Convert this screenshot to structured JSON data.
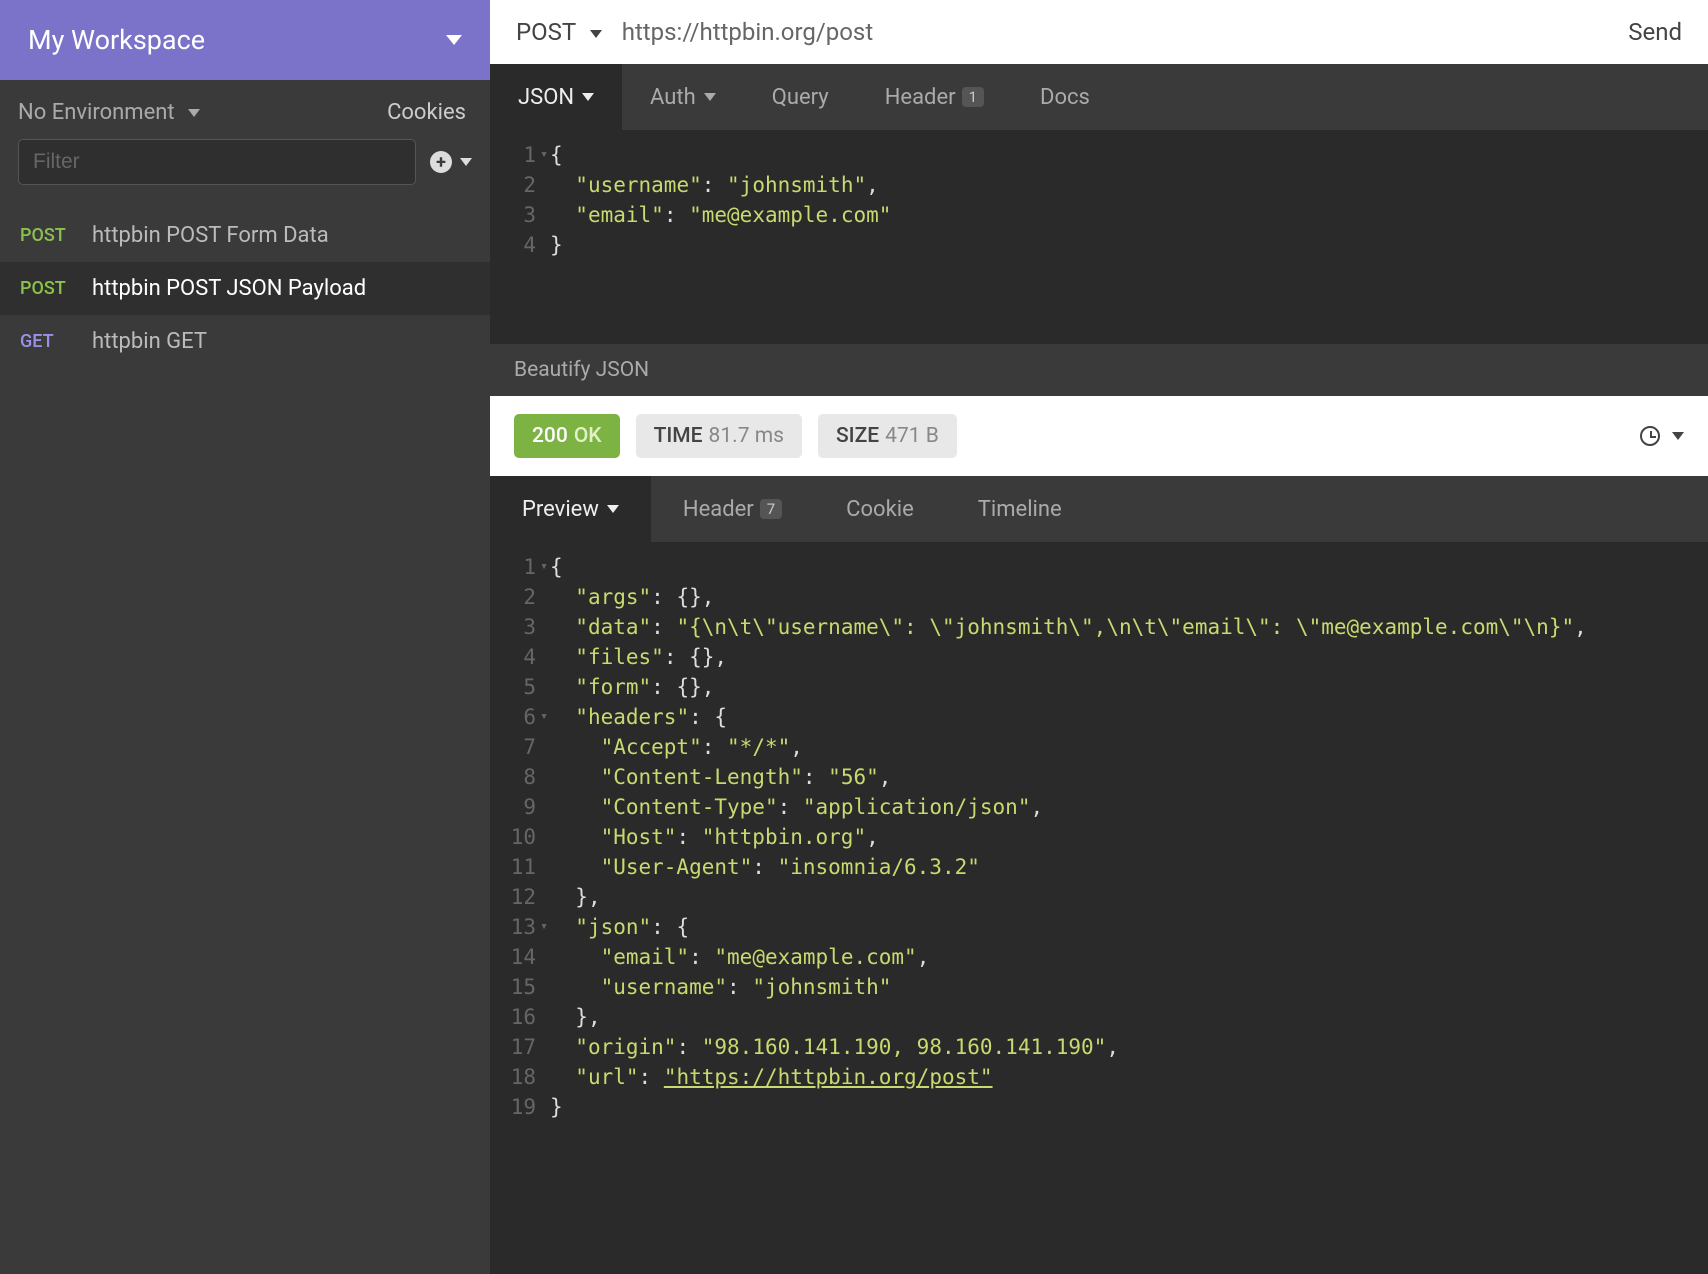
{
  "workspace": {
    "name": "My Workspace"
  },
  "sidebar": {
    "environment_label": "No Environment",
    "cookies_label": "Cookies",
    "filter_placeholder": "Filter",
    "requests": [
      {
        "method": "POST",
        "label": "httpbin POST Form Data",
        "active": false
      },
      {
        "method": "POST",
        "label": "httpbin POST JSON Payload",
        "active": true
      },
      {
        "method": "GET",
        "label": "httpbin GET",
        "active": false
      }
    ]
  },
  "url_bar": {
    "method": "POST",
    "url": "https://httpbin.org/post",
    "send_label": "Send"
  },
  "request_tabs": {
    "body": "JSON",
    "auth": "Auth",
    "query": "Query",
    "header": "Header",
    "header_badge": "1",
    "docs": "Docs"
  },
  "request_body_lines": [
    {
      "n": "1",
      "indent": 0,
      "fold": true,
      "tokens": [
        {
          "t": "punct",
          "v": "{"
        }
      ]
    },
    {
      "n": "2",
      "indent": 1,
      "tokens": [
        {
          "t": "key",
          "v": "\"username\""
        },
        {
          "t": "punct",
          "v": ": "
        },
        {
          "t": "str",
          "v": "\"johnsmith\""
        },
        {
          "t": "punct",
          "v": ","
        }
      ]
    },
    {
      "n": "3",
      "indent": 1,
      "tokens": [
        {
          "t": "key",
          "v": "\"email\""
        },
        {
          "t": "punct",
          "v": ": "
        },
        {
          "t": "str",
          "v": "\"me@example.com\""
        }
      ]
    },
    {
      "n": "4",
      "indent": 0,
      "tokens": [
        {
          "t": "punct",
          "v": "}"
        }
      ]
    }
  ],
  "beautify_label": "Beautify JSON",
  "status": {
    "code": "200",
    "text": "OK",
    "time_label": "TIME",
    "time_value": "81.7 ms",
    "size_label": "SIZE",
    "size_value": "471 B"
  },
  "response_tabs": {
    "preview": "Preview",
    "header": "Header",
    "header_badge": "7",
    "cookie": "Cookie",
    "timeline": "Timeline"
  },
  "response_body_lines": [
    {
      "n": "1",
      "indent": 0,
      "fold": true,
      "tokens": [
        {
          "t": "punct",
          "v": "{"
        }
      ]
    },
    {
      "n": "2",
      "indent": 1,
      "tokens": [
        {
          "t": "key",
          "v": "\"args\""
        },
        {
          "t": "punct",
          "v": ": {},"
        }
      ]
    },
    {
      "n": "3",
      "indent": 1,
      "tokens": [
        {
          "t": "key",
          "v": "\"data\""
        },
        {
          "t": "punct",
          "v": ": "
        },
        {
          "t": "str",
          "v": "\"{\\n\\t\\\"username\\\": \\\"johnsmith\\\",\\n\\t\\\"email\\\": \\\"me@example.com\\\"\\n}\""
        },
        {
          "t": "punct",
          "v": ","
        }
      ]
    },
    {
      "n": "4",
      "indent": 1,
      "tokens": [
        {
          "t": "key",
          "v": "\"files\""
        },
        {
          "t": "punct",
          "v": ": {},"
        }
      ]
    },
    {
      "n": "5",
      "indent": 1,
      "tokens": [
        {
          "t": "key",
          "v": "\"form\""
        },
        {
          "t": "punct",
          "v": ": {},"
        }
      ]
    },
    {
      "n": "6",
      "indent": 1,
      "fold": true,
      "tokens": [
        {
          "t": "key",
          "v": "\"headers\""
        },
        {
          "t": "punct",
          "v": ": {"
        }
      ]
    },
    {
      "n": "7",
      "indent": 2,
      "tokens": [
        {
          "t": "key",
          "v": "\"Accept\""
        },
        {
          "t": "punct",
          "v": ": "
        },
        {
          "t": "str",
          "v": "\"*/*\""
        },
        {
          "t": "punct",
          "v": ","
        }
      ]
    },
    {
      "n": "8",
      "indent": 2,
      "tokens": [
        {
          "t": "key",
          "v": "\"Content-Length\""
        },
        {
          "t": "punct",
          "v": ": "
        },
        {
          "t": "str",
          "v": "\"56\""
        },
        {
          "t": "punct",
          "v": ","
        }
      ]
    },
    {
      "n": "9",
      "indent": 2,
      "tokens": [
        {
          "t": "key",
          "v": "\"Content-Type\""
        },
        {
          "t": "punct",
          "v": ": "
        },
        {
          "t": "str",
          "v": "\"application/json\""
        },
        {
          "t": "punct",
          "v": ","
        }
      ]
    },
    {
      "n": "10",
      "indent": 2,
      "tokens": [
        {
          "t": "key",
          "v": "\"Host\""
        },
        {
          "t": "punct",
          "v": ": "
        },
        {
          "t": "str",
          "v": "\"httpbin.org\""
        },
        {
          "t": "punct",
          "v": ","
        }
      ]
    },
    {
      "n": "11",
      "indent": 2,
      "tokens": [
        {
          "t": "key",
          "v": "\"User-Agent\""
        },
        {
          "t": "punct",
          "v": ": "
        },
        {
          "t": "str",
          "v": "\"insomnia/6.3.2\""
        }
      ]
    },
    {
      "n": "12",
      "indent": 1,
      "tokens": [
        {
          "t": "punct",
          "v": "},"
        }
      ]
    },
    {
      "n": "13",
      "indent": 1,
      "fold": true,
      "tokens": [
        {
          "t": "key",
          "v": "\"json\""
        },
        {
          "t": "punct",
          "v": ": {"
        }
      ]
    },
    {
      "n": "14",
      "indent": 2,
      "tokens": [
        {
          "t": "key",
          "v": "\"email\""
        },
        {
          "t": "punct",
          "v": ": "
        },
        {
          "t": "str",
          "v": "\"me@example.com\""
        },
        {
          "t": "punct",
          "v": ","
        }
      ]
    },
    {
      "n": "15",
      "indent": 2,
      "tokens": [
        {
          "t": "key",
          "v": "\"username\""
        },
        {
          "t": "punct",
          "v": ": "
        },
        {
          "t": "str",
          "v": "\"johnsmith\""
        }
      ]
    },
    {
      "n": "16",
      "indent": 1,
      "tokens": [
        {
          "t": "punct",
          "v": "},"
        }
      ]
    },
    {
      "n": "17",
      "indent": 1,
      "tokens": [
        {
          "t": "key",
          "v": "\"origin\""
        },
        {
          "t": "punct",
          "v": ": "
        },
        {
          "t": "str",
          "v": "\"98.160.141.190, 98.160.141.190\""
        },
        {
          "t": "punct",
          "v": ","
        }
      ]
    },
    {
      "n": "18",
      "indent": 1,
      "tokens": [
        {
          "t": "key",
          "v": "\"url\""
        },
        {
          "t": "punct",
          "v": ": "
        },
        {
          "t": "link",
          "v": "\"https://httpbin.org/post\""
        }
      ]
    },
    {
      "n": "19",
      "indent": 0,
      "tokens": [
        {
          "t": "punct",
          "v": "}"
        }
      ]
    }
  ]
}
